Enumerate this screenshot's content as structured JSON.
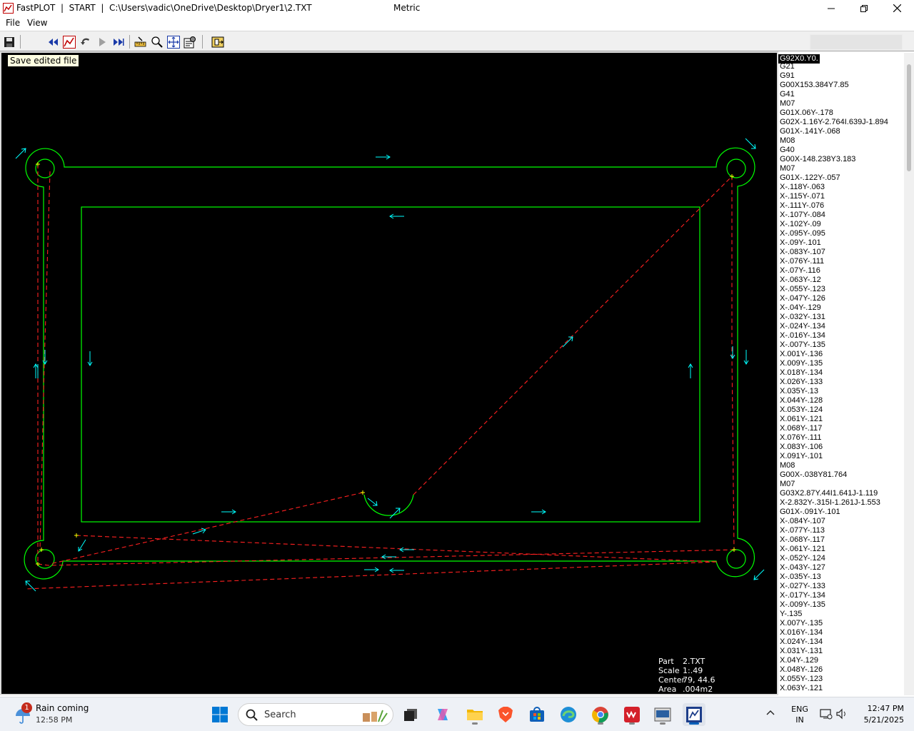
{
  "window": {
    "title": "FastPLOT  |  START  |  C:\\Users\\vadic\\OneDrive\\Desktop\\Dryer1\\2.TXT",
    "units": "Metric",
    "controls": [
      "minimize",
      "maximize",
      "close"
    ]
  },
  "menu": {
    "items": [
      "File",
      "View"
    ]
  },
  "toolbar": {
    "buttons": [
      {
        "name": "save-icon"
      },
      {
        "name": "rewind-icon"
      },
      {
        "name": "plot-icon"
      },
      {
        "name": "step-back-icon"
      },
      {
        "name": "play-icon"
      },
      {
        "name": "fast-forward-icon"
      },
      {
        "name": "measure-icon"
      },
      {
        "name": "zoom-icon"
      },
      {
        "name": "fit-icon"
      },
      {
        "name": "settings-icon"
      },
      {
        "name": "exit-icon"
      }
    ],
    "tooltip": "Save edited file"
  },
  "canvas": {
    "colors": {
      "background": "#000000",
      "part": "#00ff00",
      "rapid": "#ff0000",
      "arrows": "#00ffff",
      "markers": "#ffff00"
    },
    "info": {
      "part_label": "Part",
      "part_value": "2.TXT",
      "scale_label": "Scale",
      "scale_value": "1:.49",
      "center_label": "Center",
      "center_value": "79, 44.6",
      "area_label": "Area",
      "area_value": ".004m2"
    }
  },
  "code_lines": [
    "G92X0.Y0.",
    "G21",
    "G91",
    "G00X153.384Y7.85",
    "G41",
    "M07",
    "G01X.06Y-.178",
    "G02X-1.16Y-2.764I.639J-1.894",
    "G01X-.141Y-.068",
    "M08",
    "G40",
    "G00X-148.238Y3.183",
    "M07",
    "G01X-.122Y-.057",
    "X-.118Y-.063",
    "X-.115Y-.071",
    "X-.111Y-.076",
    "X-.107Y-.084",
    "X-.102Y-.09",
    "X-.095Y-.095",
    "X-.09Y-.101",
    "X-.083Y-.107",
    "X-.076Y-.111",
    "X-.07Y-.116",
    "X-.063Y-.12",
    "X-.055Y-.123",
    "X-.047Y-.126",
    "X-.04Y-.129",
    "X-.032Y-.131",
    "X-.024Y-.134",
    "X-.016Y-.134",
    "X-.007Y-.135",
    "X.001Y-.136",
    "X.009Y-.135",
    "X.018Y-.134",
    "X.026Y-.133",
    "X.035Y-.13",
    "X.044Y-.128",
    "X.053Y-.124",
    "X.061Y-.121",
    "X.068Y-.117",
    "X.076Y-.111",
    "X.083Y-.106",
    "X.091Y-.101",
    "M08",
    "G00X-.038Y81.764",
    "M07",
    "G03X2.87Y.44I1.641J-1.119",
    "X-2.832Y-.315I-1.261J-1.553",
    "G01X-.091Y-.101",
    "X-.084Y-.107",
    "X-.077Y-.113",
    "X-.068Y-.117",
    "X-.061Y-.121",
    "X-.052Y-.124",
    "X-.043Y-.127",
    "X-.035Y-.13",
    "X-.027Y-.133",
    "X-.017Y-.134",
    "X-.009Y-.135",
    "Y-.135",
    "X.007Y-.135",
    "X.016Y-.134",
    "X.024Y-.134",
    "X.031Y-.131",
    "X.04Y-.129",
    "X.048Y-.126",
    "X.055Y-.123",
    "X.063Y-.121"
  ],
  "taskbar": {
    "weather": {
      "badge": "1",
      "title": "Rain coming",
      "time": "12:58 PM"
    },
    "search_placeholder": "Search",
    "apps": [
      "start-icon",
      "search-icon",
      "task-view-icon",
      "copilot-icon",
      "file-explorer-icon",
      "brave-icon",
      "store-icon",
      "edge-icon",
      "chrome-icon",
      "solidworks-icon",
      "fastcam-icon",
      "fastplot-icon"
    ],
    "lang_line1": "ENG",
    "lang_line2": "IN",
    "clock_time": "12:47 PM",
    "clock_date": "5/21/2025"
  }
}
